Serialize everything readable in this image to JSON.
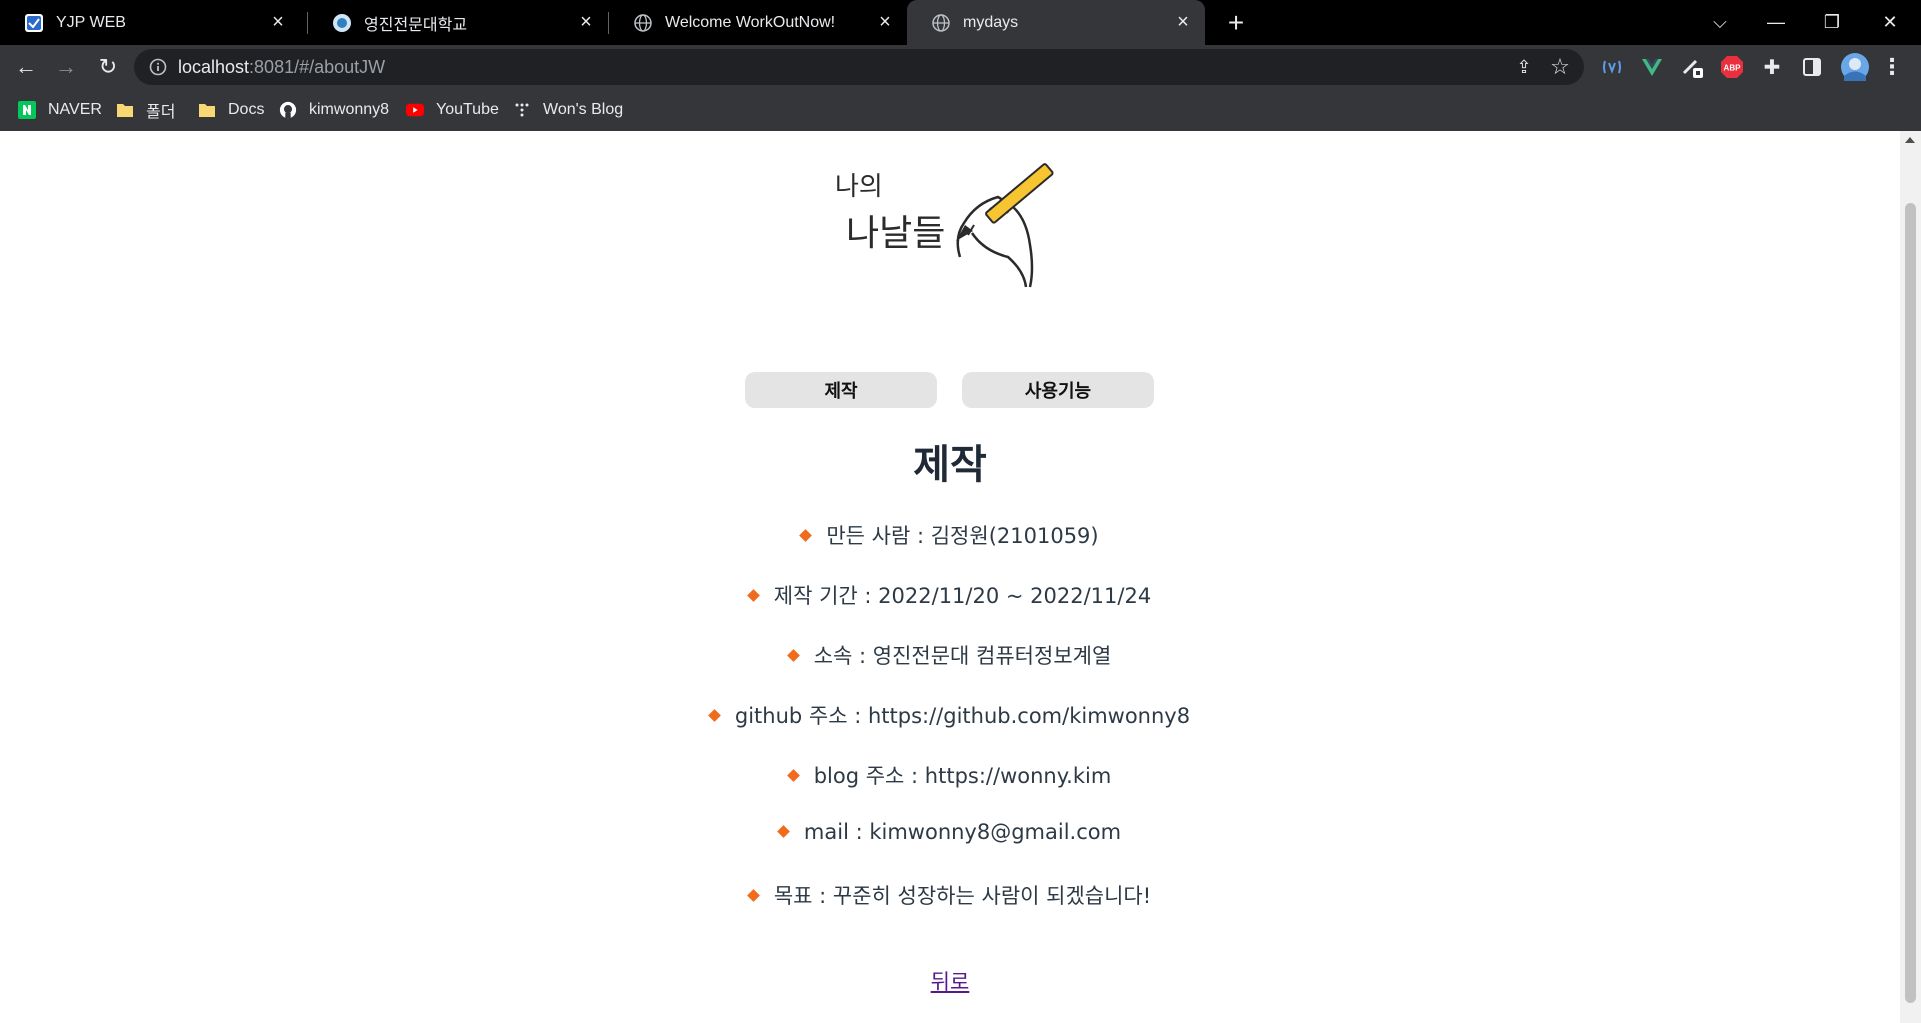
{
  "browser": {
    "tabs": [
      {
        "title": "YJP WEB",
        "active": false
      },
      {
        "title": "영진전문대학교",
        "active": false
      },
      {
        "title": "Welcome WorkOutNow!",
        "active": false
      },
      {
        "title": "mydays",
        "active": true
      }
    ],
    "address": {
      "host": "localhost",
      "path": ":8081/#/aboutJW"
    },
    "bookmarks": [
      "NAVER",
      "폴더",
      "Docs",
      "kimwonny8",
      "YouTube",
      "Won's Blog"
    ],
    "icons": {
      "tab_close": "×",
      "new_tab": "+",
      "tab_list": "⌵",
      "minimize": "—",
      "restore": "❐",
      "close": "✕",
      "back": "←",
      "forward": "→",
      "reload": "↻",
      "share": "⇪",
      "star": "☆",
      "extensions": "✚",
      "side_panel": "▯",
      "menu": "⋮",
      "abp": "ABP"
    }
  },
  "page": {
    "logo": {
      "line1": "나의",
      "line2": "나날들"
    },
    "tab_buttons": [
      "제작",
      "사용기능"
    ],
    "heading": "제작",
    "info": [
      "만든 사람 : 김정원(2101059)",
      "제작 기간 : 2022/11/20 ~ 2022/11/24",
      "소속 : 영진전문대 컴퓨터정보계열",
      "github 주소 : https://github.com/kimwonny8",
      "blog 주소 : https://wonny.kim",
      "mail : kimwonny8@gmail.com",
      "목표 : 꾸준히 성장하는 사람이 되겠습니다!"
    ],
    "back_link": "뒤로"
  },
  "colors": {
    "bullet": "#f26b1d",
    "heading": "#1f2a36",
    "button_bg": "#e4e4e4",
    "link": "#551a8b",
    "pencil": "#f7c531"
  }
}
